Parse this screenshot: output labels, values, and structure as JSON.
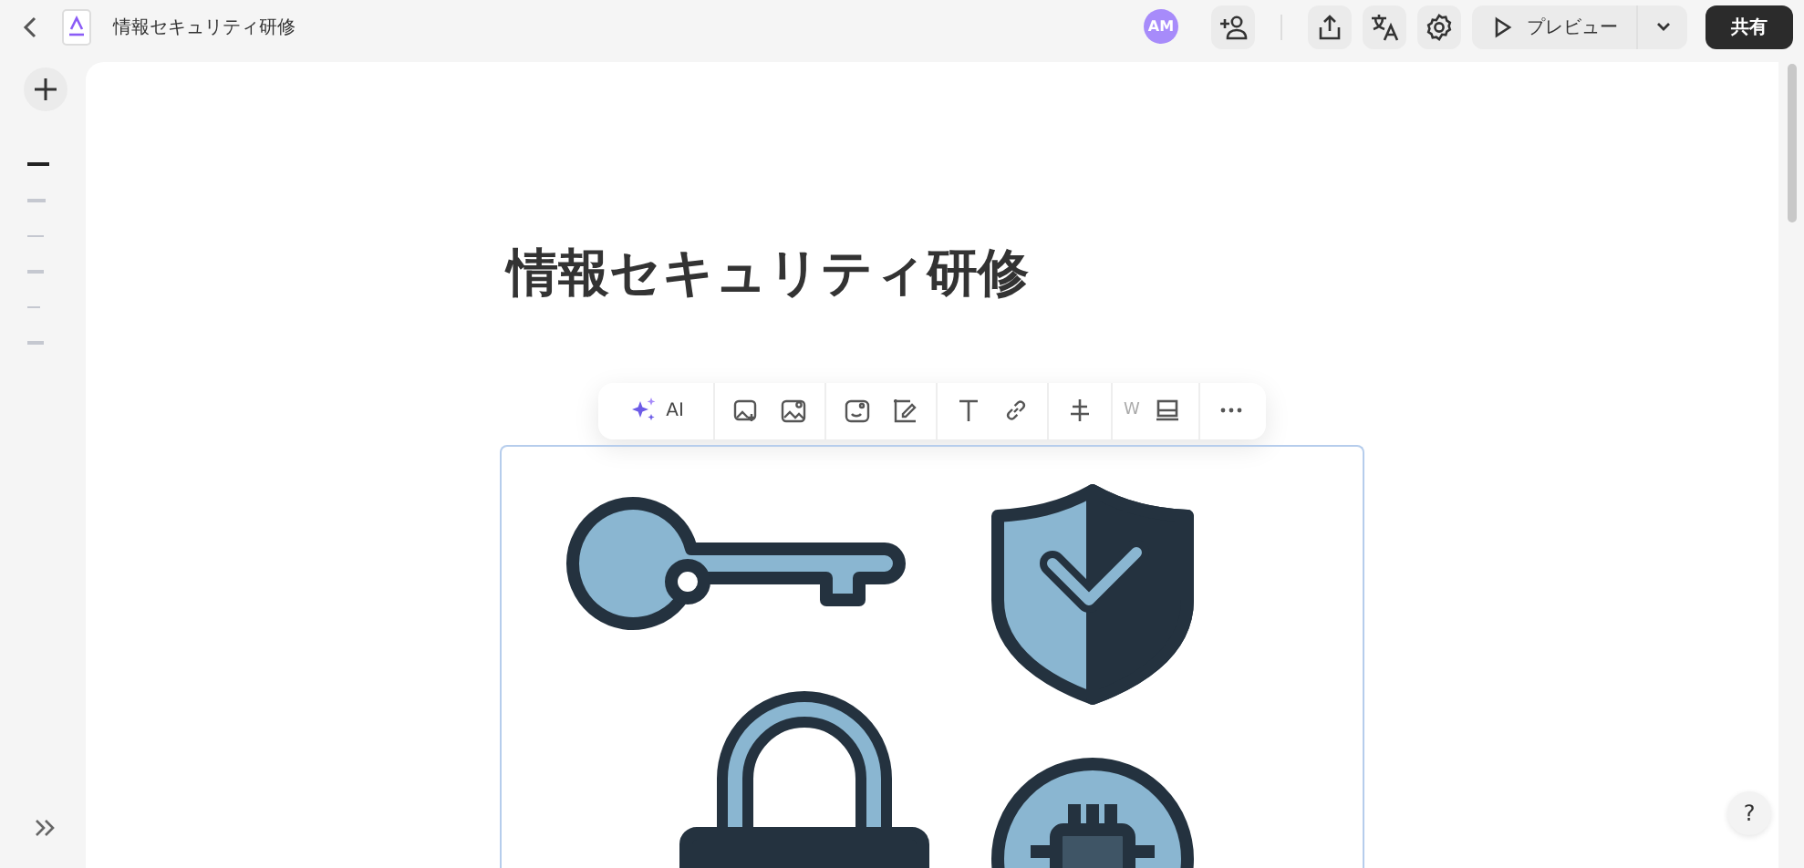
{
  "topbar": {
    "doc_title": "情報セキュリティ研修",
    "avatar": "AM",
    "preview_button": "プレビュー",
    "share_button": "共有"
  },
  "outline": [
    {
      "selected": true
    },
    {
      "selected": false
    },
    {
      "selected": false
    },
    {
      "selected": false
    },
    {
      "selected": false
    },
    {
      "selected": false
    }
  ],
  "document": {
    "title": "情報セキュリティ研修"
  },
  "toolbar": {
    "ai_label": "AI",
    "width_label": "W"
  },
  "help": "?"
}
